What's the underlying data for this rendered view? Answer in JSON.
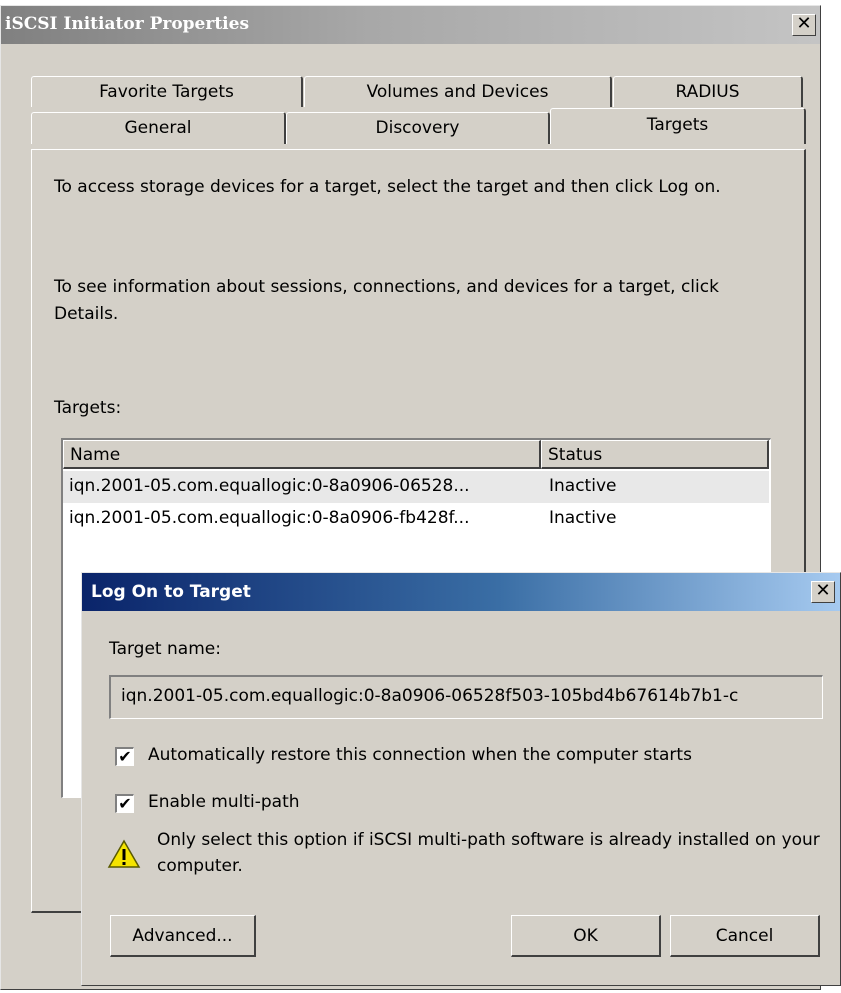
{
  "main_window": {
    "title": "iSCSI Initiator Properties",
    "close_glyph": "✕",
    "tabs_back": [
      "Favorite Targets",
      "Volumes and Devices",
      "RADIUS"
    ],
    "tabs_front": [
      "General",
      "Discovery",
      "Targets"
    ],
    "active_tab": "Targets",
    "instructions_1": "To access storage devices for a target, select the target and then click Log on.",
    "instructions_2": "To see information about sessions, connections, and devices for a target, click Details.",
    "targets_label": "Targets:",
    "list": {
      "columns": [
        "Name",
        "Status"
      ],
      "rows": [
        {
          "name": "iqn.2001-05.com.equallogic:0-8a0906-06528...",
          "status": "Inactive"
        },
        {
          "name": "iqn.2001-05.com.equallogic:0-8a0906-fb428f...",
          "status": "Inactive"
        }
      ]
    }
  },
  "dialog": {
    "title": "Log On to Target",
    "close_glyph": "✕",
    "target_name_label": "Target name:",
    "target_name_value": "iqn.2001-05.com.equallogic:0-8a0906-06528f503-105bd4b67614b7b1-c",
    "auto_restore_label": "Automatically restore this connection when the computer starts",
    "auto_restore_checked": true,
    "multipath_label": "Enable multi-path",
    "multipath_checked": true,
    "warning_text": "Only select this option if iSCSI multi-path software is already installed on your computer.",
    "buttons": {
      "advanced": "Advanced...",
      "ok": "OK",
      "cancel": "Cancel"
    },
    "check_glyph": "✔"
  }
}
